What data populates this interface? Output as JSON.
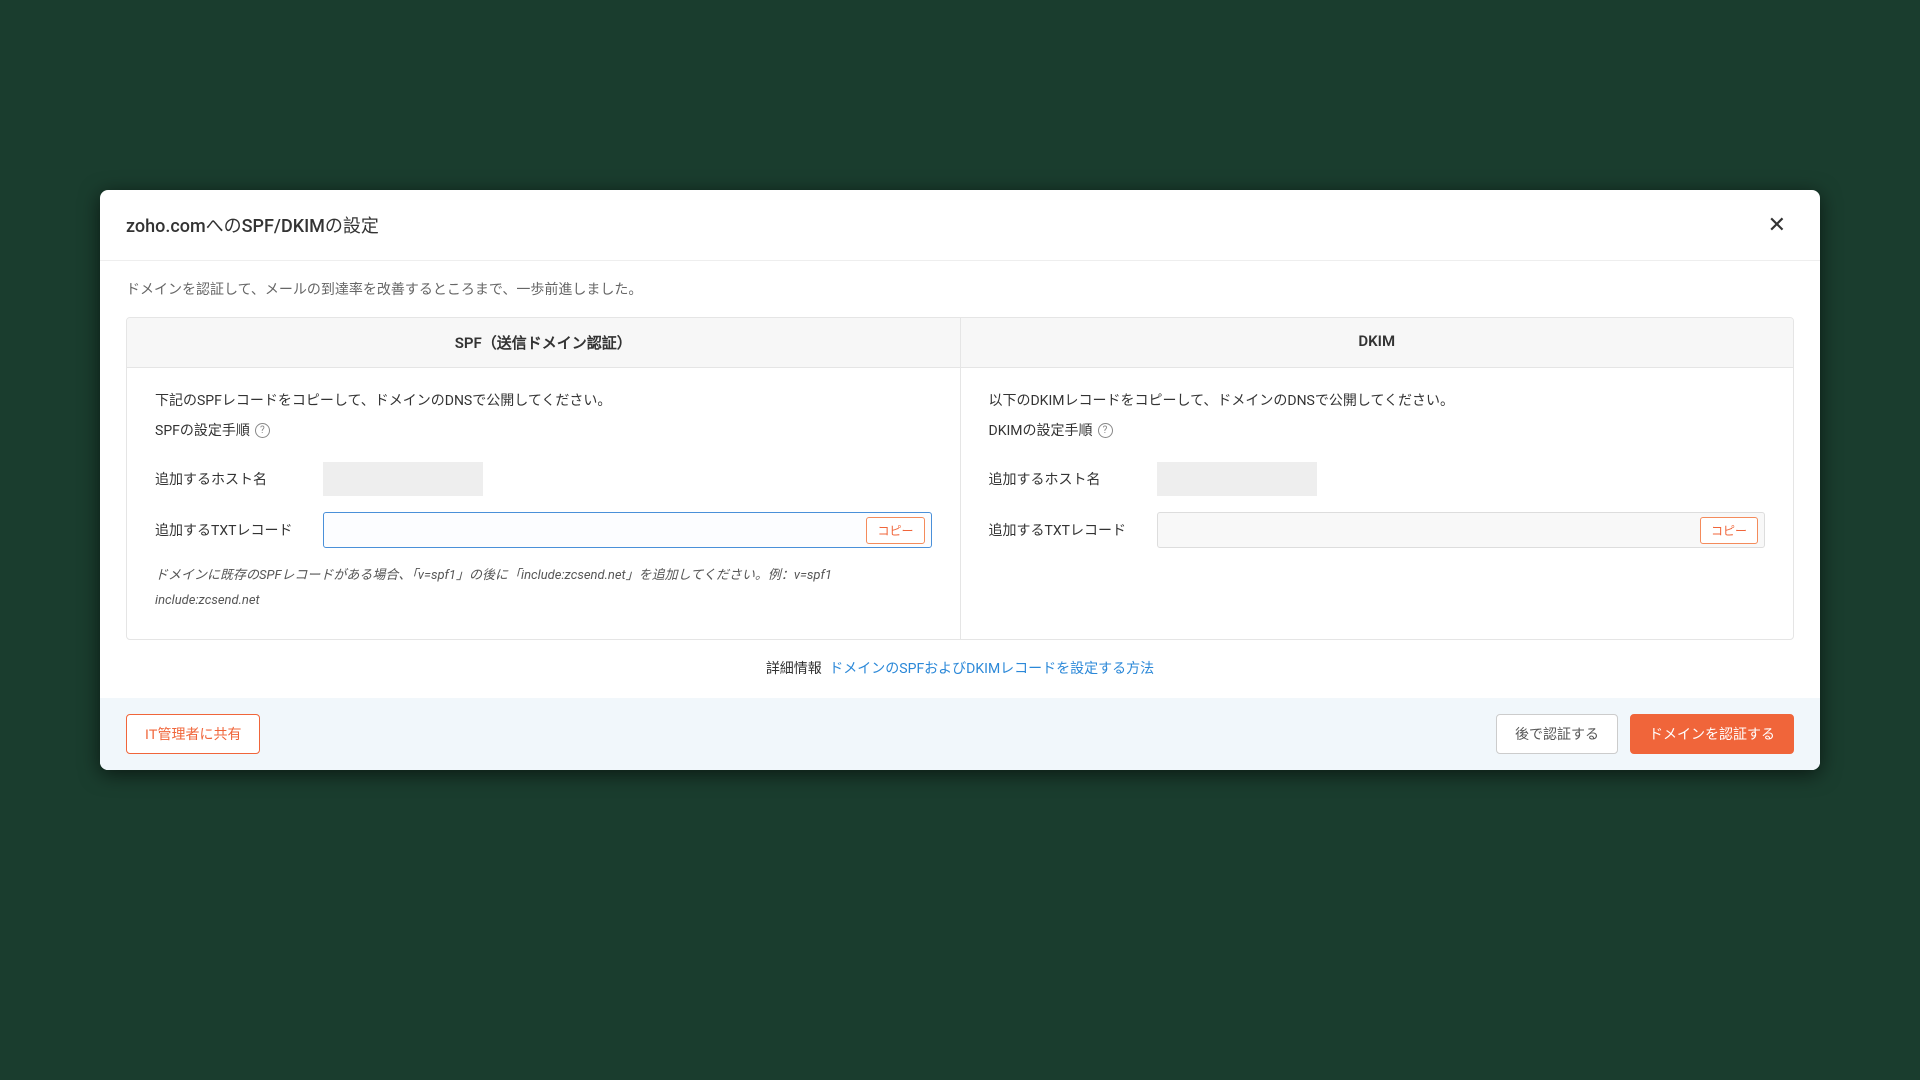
{
  "modal": {
    "title": "zoho.comへのSPF/DKIMの設定",
    "intro": "ドメインを認証して、メールの到達率を改善するところまで、一歩前進しました。",
    "headers": {
      "spf": "SPF（送信ドメイン認証）",
      "dkim": "DKIM"
    },
    "spf": {
      "instruction": "下記のSPFレコードをコピーして、ドメインのDNSで公開してください。",
      "steps_label": "SPFの設定手順",
      "host_label": "追加するホスト名",
      "txt_label": "追加するTXTレコード",
      "copy_label": "コピー",
      "note": "ドメインに既存のSPFレコードがある場合、「v=spf1」の後に「include:zcsend.net」を追加してください。例：v=spf1 include:zcsend.net"
    },
    "dkim": {
      "instruction": "以下のDKIMレコードをコピーして、ドメインのDNSで公開してください。",
      "steps_label": "DKIMの設定手順",
      "host_label": "追加するホスト名",
      "txt_label": "追加するTXTレコード",
      "copy_label": "コピー"
    },
    "details": {
      "label": "詳細情報",
      "link_text": "ドメインのSPFおよびDKIMレコードを設定する方法"
    },
    "footer": {
      "share_it": "IT管理者に共有",
      "later": "後で認証する",
      "verify": "ドメインを認証する"
    }
  }
}
